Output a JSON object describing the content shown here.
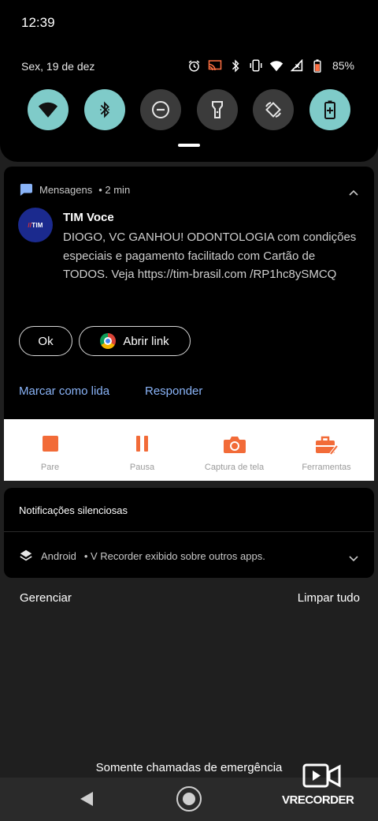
{
  "status_bar": {
    "time": "12:39",
    "date": "Sex, 19 de dez",
    "battery": "85%",
    "icons": [
      "alarm-icon",
      "cast-icon",
      "bluetooth-icon",
      "vibrate-icon",
      "wifi-icon",
      "signal-icon",
      "battery-icon"
    ]
  },
  "quick_tiles": [
    {
      "name": "wifi-icon",
      "state": "on"
    },
    {
      "name": "bluetooth-icon",
      "state": "on"
    },
    {
      "name": "do-not-disturb-icon",
      "state": "off"
    },
    {
      "name": "flashlight-icon",
      "state": "off"
    },
    {
      "name": "auto-rotate-icon",
      "state": "off"
    },
    {
      "name": "battery-saver-icon",
      "state": "on"
    }
  ],
  "notification": {
    "app": "Mensagens",
    "time": "• 2 min",
    "sender": "TIM Voce",
    "body": "DIOGO, VC GANHOU! ODONTOLOGIA com condições especiais e pagamento facilitado com Cartão de TODOS. Veja https://tim-brasil.com /RP1hc8ySMCQ",
    "avatar_text": "TIM",
    "buttons": {
      "ok": "Ok",
      "open_link": "Abrir link"
    },
    "actions": {
      "mark_read": "Marcar como lida",
      "reply": "Responder"
    }
  },
  "recorder_bar": {
    "items": [
      {
        "label": "Pare",
        "icon": "stop-icon"
      },
      {
        "label": "Pausa",
        "icon": "pause-icon"
      },
      {
        "label": "Captura de tela",
        "icon": "camera-icon"
      },
      {
        "label": "Ferramentas",
        "icon": "toolbox-icon"
      }
    ]
  },
  "silent": {
    "title": "Notificações silenciosas",
    "app": "Android",
    "text": "• V Recorder exibido sobre outros apps."
  },
  "footer": {
    "manage": "Gerenciar",
    "clear_all": "Limpar tudo"
  },
  "emergency_text": "Somente chamadas de emergência",
  "watermark": "VRECORDER",
  "colors": {
    "tile_on": "#7fcbc9",
    "tile_off": "#3b3b3b",
    "action_blue": "#8ab4f8",
    "recorder_orange": "#f26b38"
  }
}
